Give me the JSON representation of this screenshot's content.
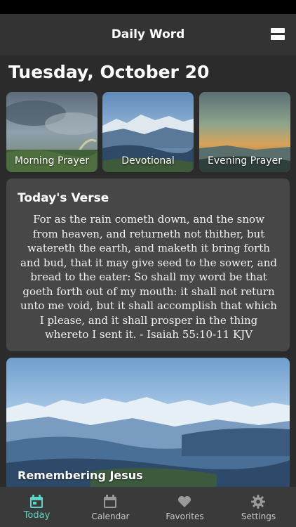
{
  "app": {
    "title": "Daily Word"
  },
  "header": {
    "menu_icon": "menu-icon"
  },
  "date": {
    "heading": "Tuesday, October 20"
  },
  "tiles": [
    {
      "label": "Morning Prayer"
    },
    {
      "label": "Devotional"
    },
    {
      "label": "Evening Prayer"
    }
  ],
  "verse": {
    "heading": "Today's Verse",
    "text": "For as the rain cometh down, and the snow from heaven, and returneth not thither, but watereth the earth, and maketh it bring forth and bud, that it may give seed to the sower, and bread to the eater: So shall my word be that goeth forth out of my mouth: it shall not return unto me void, but it shall accomplish that which I please, and it shall prosper in the thing whereto I sent it. - Isaiah 55:10-11 KJV"
  },
  "feature": {
    "title": "Remembering Jesus"
  },
  "tabs": [
    {
      "label": "Today",
      "icon": "calendar-today-icon",
      "active": true
    },
    {
      "label": "Calendar",
      "icon": "calendar-icon",
      "active": false
    },
    {
      "label": "Favorites",
      "icon": "heart-icon",
      "active": false
    },
    {
      "label": "Settings",
      "icon": "gear-icon",
      "active": false
    }
  ],
  "colors": {
    "accent": "#5fd4c4",
    "card": "#474747",
    "background": "#2b2b2b"
  }
}
